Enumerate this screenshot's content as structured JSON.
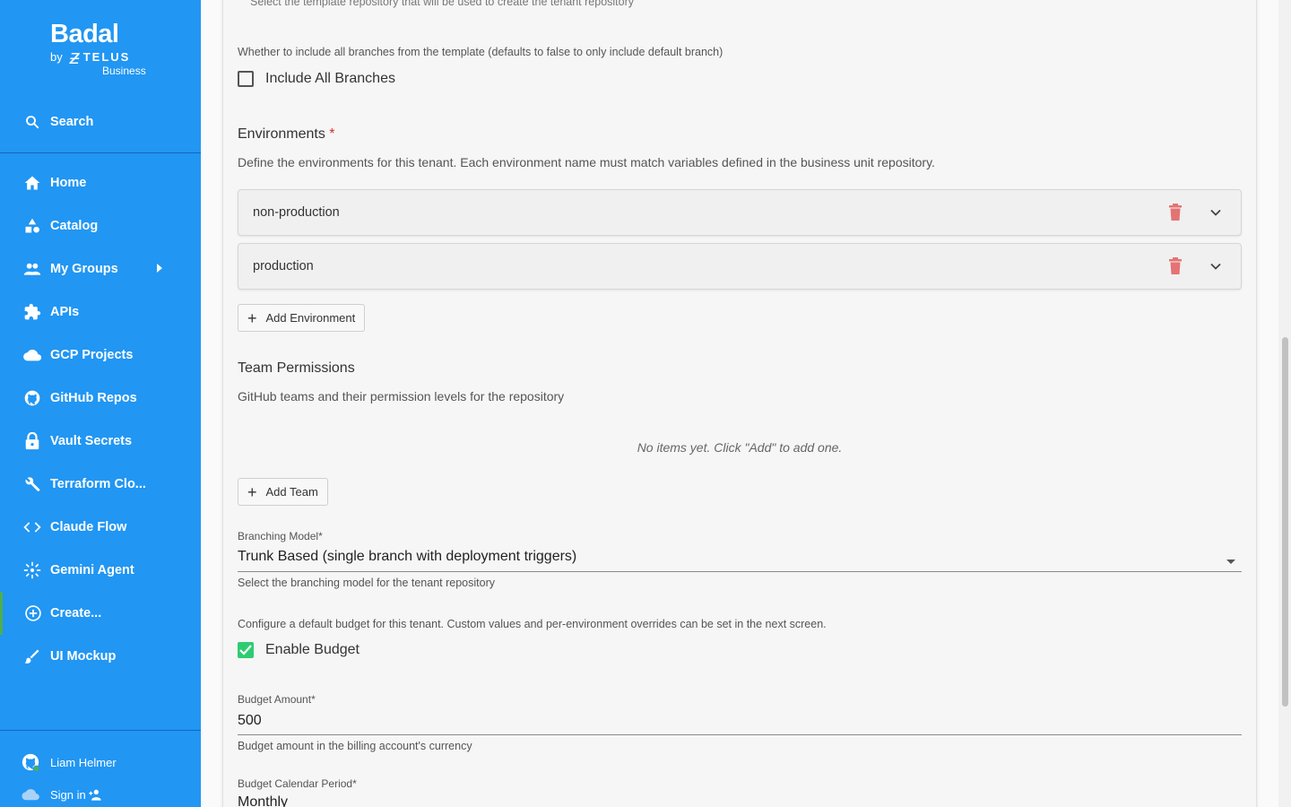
{
  "sidebar": {
    "logo": {
      "brand": "Badal",
      "by": "by",
      "telus": "TELUS",
      "business": "Business"
    },
    "search": "Search",
    "items": [
      {
        "label": "Home",
        "icon": "home-icon"
      },
      {
        "label": "Catalog",
        "icon": "catalog-icon"
      },
      {
        "label": "My Groups",
        "icon": "groups-icon"
      },
      {
        "label": "APIs",
        "icon": "puzzle-icon"
      },
      {
        "label": "GCP Projects",
        "icon": "cloud-icon"
      },
      {
        "label": "GitHub Repos",
        "icon": "github-icon"
      },
      {
        "label": "Vault Secrets",
        "icon": "lock-icon"
      },
      {
        "label": "Terraform Clo...",
        "icon": "wrench-icon"
      },
      {
        "label": "Claude Flow",
        "icon": "code-icon"
      },
      {
        "label": "Gemini Agent",
        "icon": "sparkle-icon"
      },
      {
        "label": "Create...",
        "icon": "add-circle-icon"
      },
      {
        "label": "UI Mockup",
        "icon": "brush-icon"
      }
    ],
    "user": {
      "name": "Liam Helmer",
      "signin": "Sign in"
    }
  },
  "form": {
    "template_hint": "Select the template repository that will be used to create the tenant repository",
    "include_branches_desc": "Whether to include all branches from the template (defaults to false to only include default branch)",
    "include_branches_label": "Include All Branches",
    "environments_title": "Environments",
    "required_mark": "*",
    "environments_desc": "Define the environments for this tenant. Each environment name must match variables defined in the business unit repository.",
    "environments": [
      "non-production",
      "production"
    ],
    "add_environment": "Add Environment",
    "team_title": "Team Permissions",
    "team_desc": "GitHub teams and their permission levels for the repository",
    "team_empty": "No items yet. Click \"Add\" to add one.",
    "add_team": "Add Team",
    "branching_label": "Branching Model",
    "branching_value": "Trunk Based (single branch with deployment triggers)",
    "branching_helper": "Select the branching model for the tenant repository",
    "budget_desc": "Configure a default budget for this tenant. Custom values and per-environment overrides can be set in the next screen.",
    "enable_budget_label": "Enable Budget",
    "budget_amount_label": "Budget Amount",
    "budget_amount_value": "500",
    "budget_amount_helper": "Budget amount in the billing account's currency",
    "budget_period_label": "Budget Calendar Period",
    "budget_period_value": "Monthly"
  },
  "colors": {
    "sidebar": "#2196f3",
    "active_indicator": "#4caf50",
    "checkbox_checked": "#2ecc71",
    "delete": "#e57373",
    "required": "#d32f2f"
  }
}
